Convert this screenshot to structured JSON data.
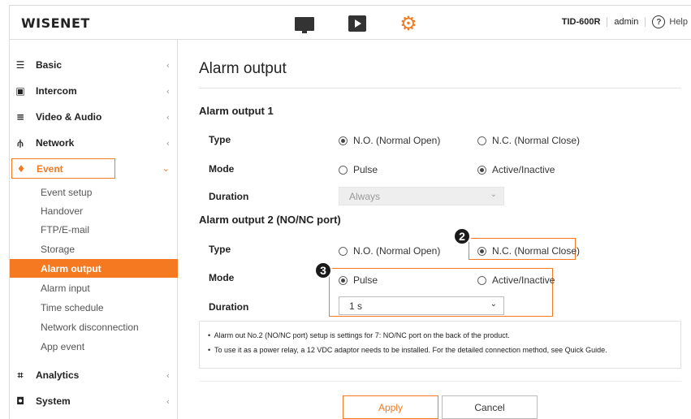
{
  "header": {
    "logo": "WISENET",
    "model": "TID-600R",
    "user": "admin",
    "help": "Help"
  },
  "sidebar": {
    "basic": "Basic",
    "intercom": "Intercom",
    "video_audio": "Video & Audio",
    "network": "Network",
    "event": "Event",
    "event_items": [
      "Event setup",
      "Handover",
      "FTP/E-mail",
      "Storage",
      "Alarm output",
      "Alarm input",
      "Time schedule",
      "Network disconnection",
      "App event"
    ],
    "analytics": "Analytics",
    "system": "System"
  },
  "page": {
    "title": "Alarm output",
    "output1": {
      "heading": "Alarm output 1",
      "type_label": "Type",
      "type_no": "N.O. (Normal Open)",
      "type_nc": "N.C. (Normal Close)",
      "type_selected": "N.O. (Normal Open)",
      "mode_label": "Mode",
      "mode_pulse": "Pulse",
      "mode_active": "Active/Inactive",
      "mode_selected": "Active/Inactive",
      "duration_label": "Duration",
      "duration_value": "Always"
    },
    "output2": {
      "heading": "Alarm output 2 (NO/NC port)",
      "type_label": "Type",
      "type_no": "N.O. (Normal Open)",
      "type_nc": "N.C. (Normal Close)",
      "type_selected": "N.C. (Normal Close)",
      "mode_label": "Mode",
      "mode_pulse": "Pulse",
      "mode_active": "Active/Inactive",
      "mode_selected": "Pulse",
      "duration_label": "Duration",
      "duration_value": "1 s"
    },
    "notes": [
      "Alarm out No.2 (NO/NC port) setup is settings for 7: NO/NC port on the back of the product.",
      "To use it as a power relay, a 12 VDC adaptor needs to be installed. For the detailed connection method, see Quick Guide."
    ],
    "apply": "Apply",
    "cancel": "Cancel"
  },
  "callouts": [
    "2",
    "3"
  ],
  "colors": {
    "accent": "#f47920",
    "text": "#333333",
    "border": "#dcdcdc"
  }
}
